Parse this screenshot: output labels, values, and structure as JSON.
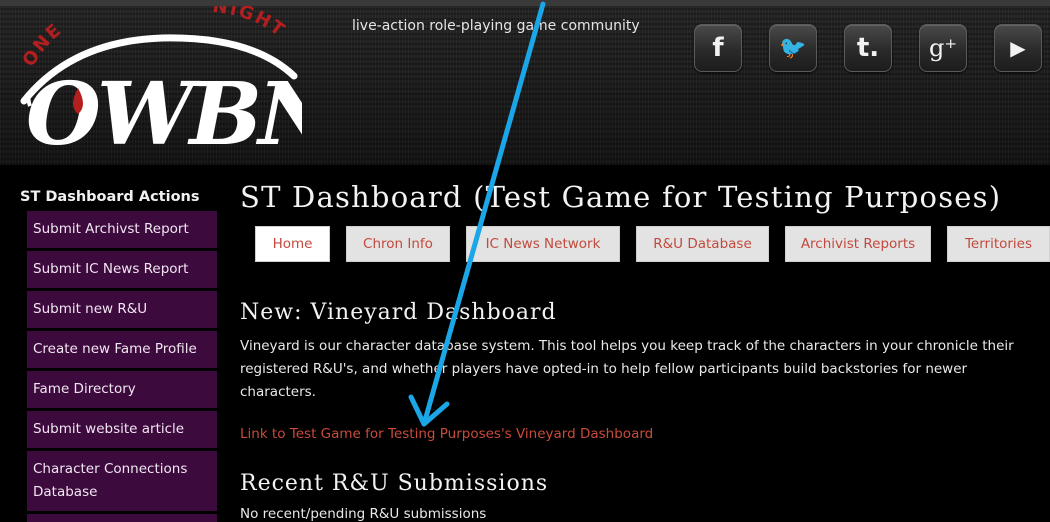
{
  "header": {
    "logo": {
      "text": "OWBN",
      "arc_left": "ONE",
      "arc_right": "NIGHT"
    },
    "tagline": "live-action role-playing game community",
    "social": [
      {
        "icon": "facebook-icon",
        "glyph": "f"
      },
      {
        "icon": "twitter-icon",
        "glyph": "🐦"
      },
      {
        "icon": "tumblr-icon",
        "glyph": "t."
      },
      {
        "icon": "google-plus-icon",
        "glyph": "g⁺"
      },
      {
        "icon": "youtube-icon",
        "glyph": "▶"
      }
    ]
  },
  "sidebar": {
    "title": "ST Dashboard Actions",
    "items": [
      {
        "label": "Submit Archivst Report"
      },
      {
        "label": "Submit IC News Report"
      },
      {
        "label": "Submit new R&U"
      },
      {
        "label": "Create new Fame Profile"
      },
      {
        "label": "Fame Directory"
      },
      {
        "label": "Submit website article"
      },
      {
        "label": "Character Connections Database"
      },
      {
        "label": ""
      }
    ]
  },
  "main": {
    "title": "ST Dashboard (Test Game for Testing Purposes)",
    "tabs": [
      {
        "label": "Home",
        "active": true
      },
      {
        "label": "Chron Info"
      },
      {
        "label": "IC News Network"
      },
      {
        "label": "R&U Database"
      },
      {
        "label": "Archivist Reports"
      },
      {
        "label": "Territories"
      }
    ],
    "vineyard": {
      "heading": "New: Vineyard Dashboard",
      "body": "Vineyard is our character database system. This tool helps you keep track of the characters in your chronicle their registered R&U's, and whether players have opted-in to help fellow participants build backstories for newer characters.",
      "link": "Link to Test Game for Testing Purposes's Vineyard Dashboard"
    },
    "recent": {
      "heading": "Recent R&U Submissions",
      "empty": "No recent/pending R&U submissions"
    }
  },
  "colors": {
    "sidebar_item_bg": "#3c0a3d",
    "tab_text": "#c24a3d",
    "link": "#c84b3a",
    "annotation_arrow": "#1ba6e8",
    "logo_red": "#b31f1f"
  }
}
